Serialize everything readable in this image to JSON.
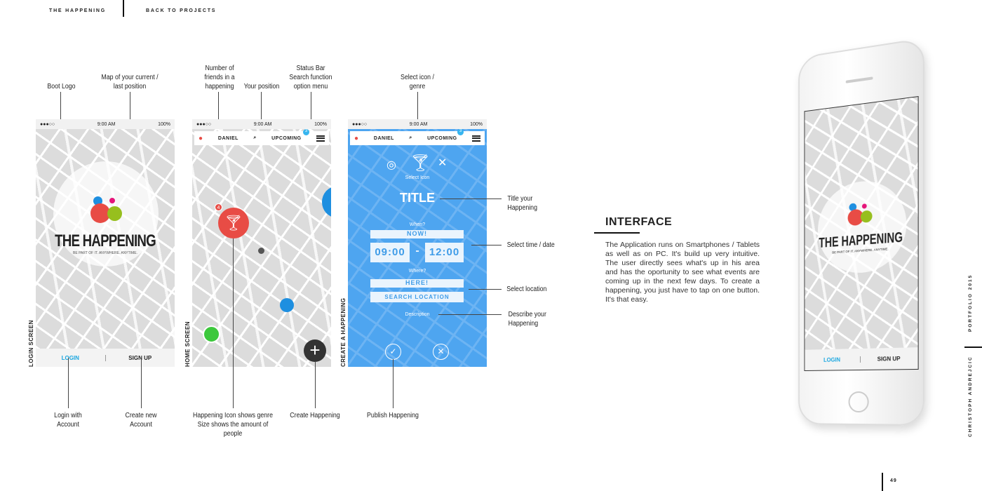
{
  "nav": {
    "title": "THE HAPPENING",
    "back": "BACK TO PROJECTS"
  },
  "status": {
    "time": "9:00 AM",
    "battery": "100%",
    "signal": "●●●○○"
  },
  "login_screen": {
    "side_label": "LOGIN SCREEN",
    "app_name": "THE HAPPENING",
    "tagline": "BE PART OF IT. ANYWHERE. ANYTIME.",
    "login": "LOGIN",
    "signup": "SIGN UP"
  },
  "home_screen": {
    "side_label": "HOME SCREEN",
    "user": "DANIEL",
    "upcoming": "UPCOMING",
    "badge": "3",
    "friends_count": "4"
  },
  "create_screen": {
    "side_label": "CREATE A HAPPENING",
    "user": "DANIEL",
    "upcoming": "UPCOMING",
    "badge": "3",
    "select_icon": "Select Icon",
    "title": "TITLE",
    "when": "When?",
    "now": "NOW!",
    "from": "09:00",
    "dash": "-",
    "to": "12:00",
    "where": "Where?",
    "here": "HERE!",
    "search_location": "SEARCH LOCATION",
    "description": "Description"
  },
  "annotations": {
    "boot_logo": "Boot Logo",
    "map": "Map of your current / last position",
    "friends": "Number of friends in a happening",
    "position": "Your position",
    "status_bar": "Status Bar Search function option menu",
    "select_icon": "Select icon / genre",
    "title": "Title your Happening",
    "time": "Select time / date",
    "location": "Select location",
    "describe": "Describe your Happening",
    "login": "Login with Account",
    "create_account": "Create new Account",
    "happening": "Happening Icon shows genre Size shows the amount of people",
    "create": "Create Happening",
    "publish": "Publish Happening"
  },
  "interface": {
    "heading": "INTERFACE",
    "body": "The Application runs on Smartphones / Tablets as well as on PC. It's build up very intuitive. The user directly sees what's up in his area and has the oportunity to see what events are coming up in the next few days. To create a happening, you just have to tap on one button. It's that easy."
  },
  "side": {
    "portfolio": "PORTFOLIO 2015",
    "author": "CHRISTOPH ANDREJCIC"
  },
  "page_number": "49",
  "colors": {
    "red": "#e84c45",
    "blue": "#1e8fe0",
    "green": "#97bf1e",
    "pink": "#e5157a",
    "app_blue": "#4ea5f0",
    "login_blue": "#1aa7e0"
  }
}
